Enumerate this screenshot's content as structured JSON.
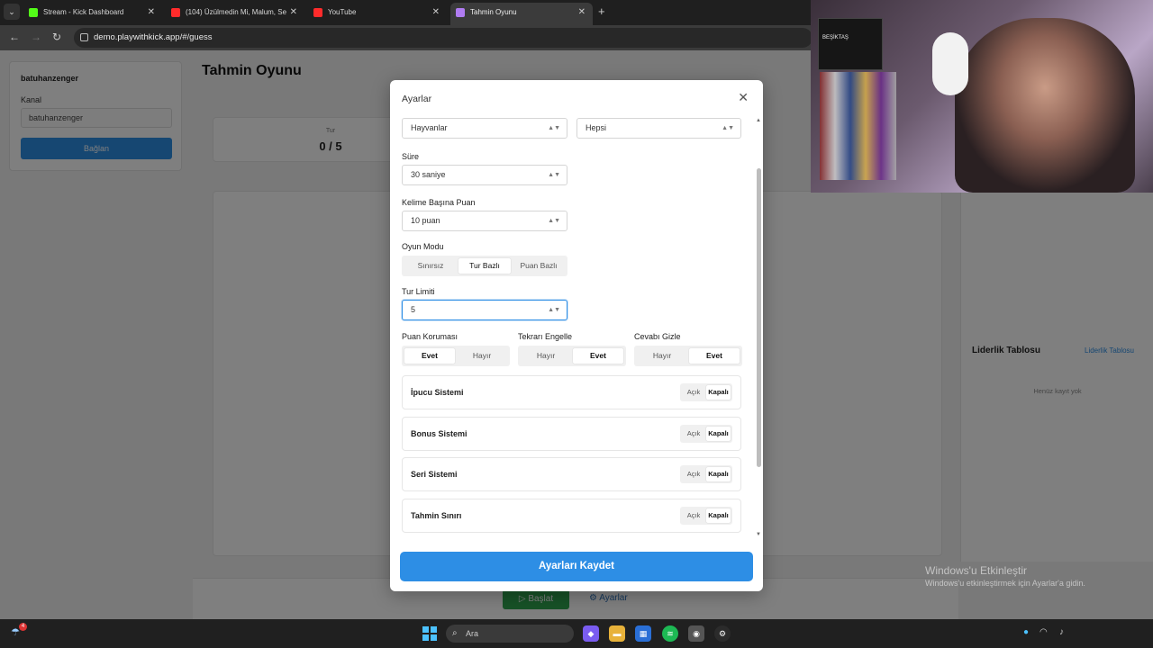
{
  "browser": {
    "tabs": [
      {
        "title": "Stream - Kick Dashboard",
        "active": false
      },
      {
        "title": "(104) Üzülmedin Mi, Malum, Se",
        "active": false
      },
      {
        "title": "YouTube",
        "active": false
      },
      {
        "title": "Tahmin Oyunu",
        "active": true
      }
    ],
    "url": "demo.playwithkick.app/#/guess"
  },
  "sidebar": {
    "username": "batuhanzenger",
    "channel_label": "Kanal",
    "channel_value": "batuhanzenger",
    "connect_label": "Bağlan"
  },
  "page": {
    "title": "Tahmin Oyunu",
    "stat_label": "Tur",
    "stat_value": "0 / 5",
    "leaderboard_title": "Liderlik Tablosu",
    "leaderboard_link": "Liderlik Tablosu",
    "leaderboard_empty": "Henüz kayıt yok",
    "start_label": "Başlat",
    "settings_label": "Ayarlar"
  },
  "modal": {
    "title": "Ayarlar",
    "category_value": "Hayvanlar",
    "difficulty_value": "Hepsi",
    "duration_label": "Süre",
    "duration_value": "30 saniye",
    "points_label": "Kelime Başına Puan",
    "points_value": "10 puan",
    "mode_label": "Oyun Modu",
    "mode_options": [
      "Sınırsız",
      "Tur Bazlı",
      "Puan Bazlı"
    ],
    "mode_selected": "Tur Bazlı",
    "round_limit_label": "Tur Limiti",
    "round_limit_value": "5",
    "score_protect_label": "Puan Koruması",
    "score_protect_options": [
      "Evet",
      "Hayır"
    ],
    "score_protect_selected": "Evet",
    "block_repeat_label": "Tekrarı Engelle",
    "block_repeat_options": [
      "Hayır",
      "Evet"
    ],
    "block_repeat_selected": "Evet",
    "hide_answer_label": "Cevabı Gizle",
    "hide_answer_options": [
      "Hayır",
      "Evet"
    ],
    "hide_answer_selected": "Evet",
    "toggles": [
      {
        "label": "İpucu Sistemi",
        "on": "Açık",
        "off": "Kapalı",
        "selected": "Kapalı"
      },
      {
        "label": "Bonus Sistemi",
        "on": "Açık",
        "off": "Kapalı",
        "selected": "Kapalı"
      },
      {
        "label": "Seri Sistemi",
        "on": "Açık",
        "off": "Kapalı",
        "selected": "Kapalı"
      },
      {
        "label": "Tahmin Sınırı",
        "on": "Açık",
        "off": "Kapalı",
        "selected": "Kapalı"
      }
    ],
    "save_label": "Ayarları Kaydet"
  },
  "webcam": {
    "flag_text": "BEŞİKTAŞ"
  },
  "windows": {
    "activate_title": "Windows'u Etkinleştir",
    "activate_subtitle": "Windows'u etkinleştirmek için Ayarlar'a gidin."
  },
  "taskbar": {
    "search_placeholder": "Ara",
    "weather_badge": "4"
  },
  "colors": {
    "accent": "#2d8ee5",
    "start_green": "#2ea44f",
    "modal_bg": "#ffffff"
  }
}
